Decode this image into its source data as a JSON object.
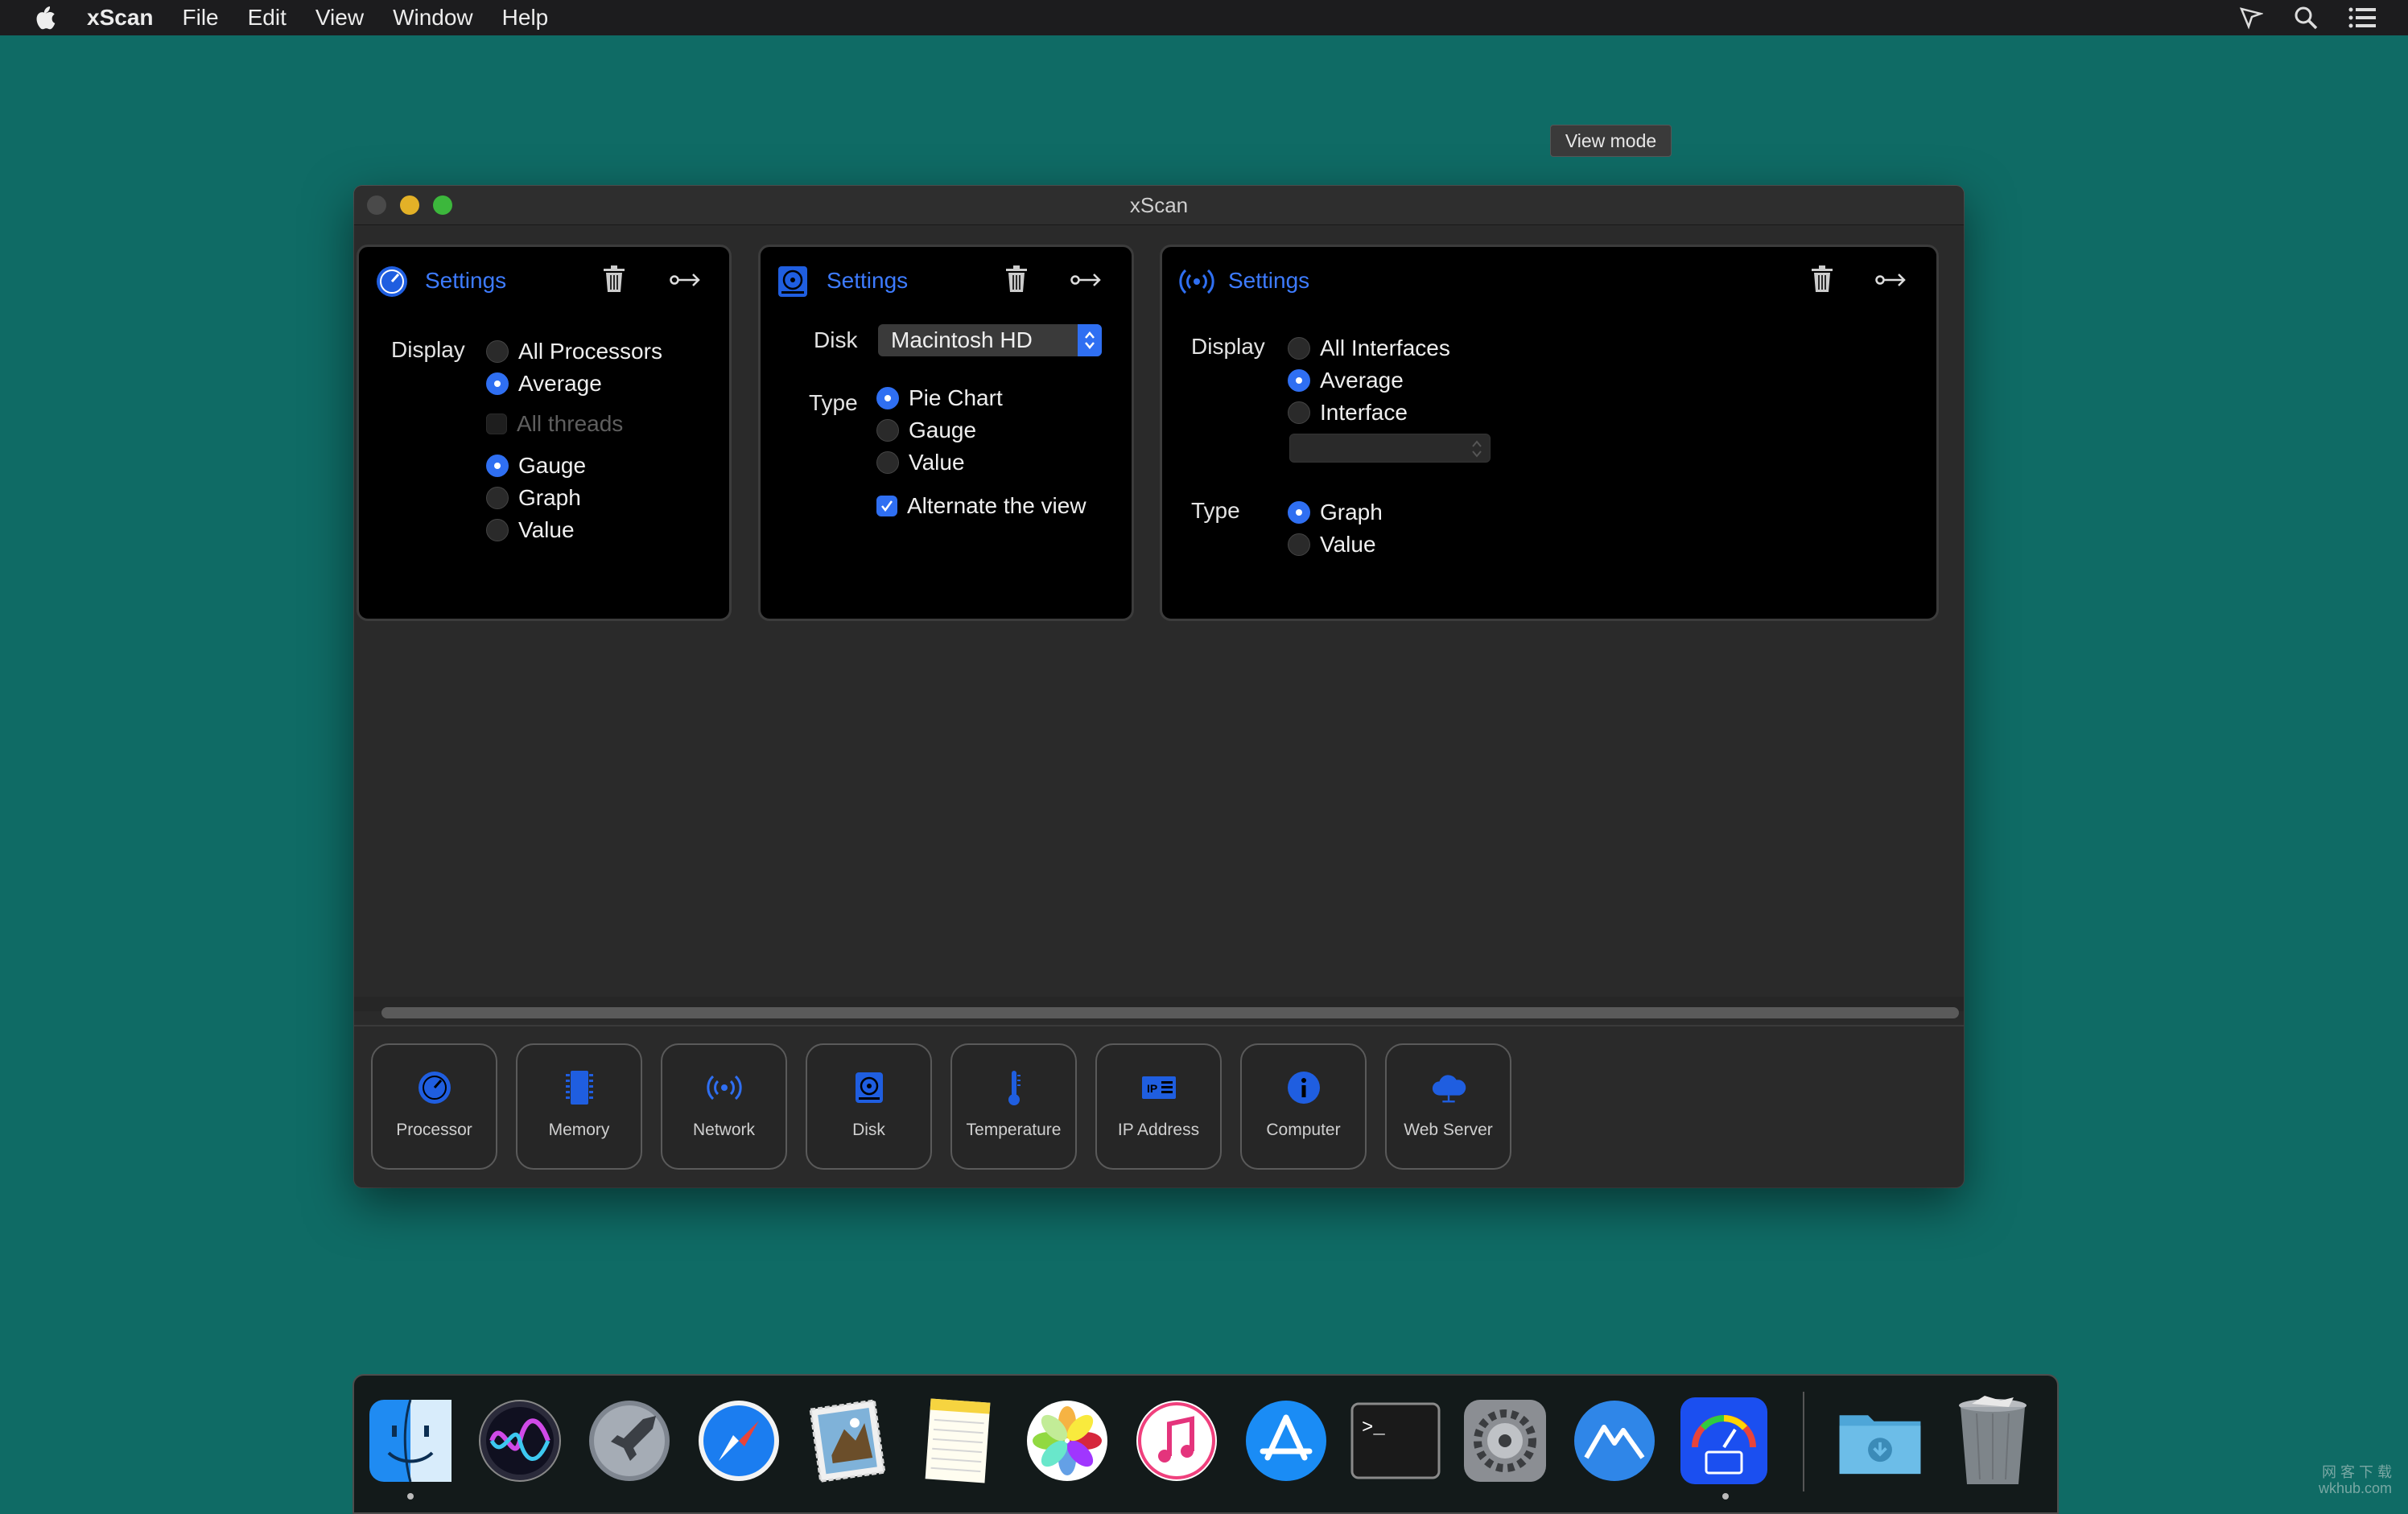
{
  "menubar": {
    "app_name": "xScan",
    "items": [
      "File",
      "Edit",
      "View",
      "Window",
      "Help"
    ]
  },
  "window": {
    "title": "xScan"
  },
  "processor_panel": {
    "title": "Settings",
    "display_label": "Display",
    "options": [
      {
        "label": "All Processors",
        "selected": false
      },
      {
        "label": "Average",
        "selected": true
      }
    ],
    "threads_checkbox": {
      "label": "All threads",
      "checked": false,
      "disabled": true
    },
    "view_options": [
      {
        "label": "Gauge",
        "selected": true
      },
      {
        "label": "Graph",
        "selected": false
      },
      {
        "label": "Value",
        "selected": false
      }
    ]
  },
  "disk_panel": {
    "title": "Settings",
    "disk_label": "Disk",
    "disk_value": "Macintosh HD",
    "type_label": "Type",
    "type_options": [
      {
        "label": "Pie Chart",
        "selected": true
      },
      {
        "label": "Gauge",
        "selected": false
      },
      {
        "label": "Value",
        "selected": false
      }
    ],
    "alternate_checkbox": {
      "label": "Alternate the view",
      "checked": true
    }
  },
  "network_panel": {
    "title": "Settings",
    "display_label": "Display",
    "display_options": [
      {
        "label": "All Interfaces",
        "selected": false
      },
      {
        "label": "Average",
        "selected": true
      },
      {
        "label": "Interface",
        "selected": false
      }
    ],
    "interface_value": "",
    "type_label": "Type",
    "type_options": [
      {
        "label": "Graph",
        "selected": true
      },
      {
        "label": "Value",
        "selected": false
      }
    ]
  },
  "tooltip": {
    "text": "View mode"
  },
  "modules": [
    {
      "label": "Processor",
      "icon": "gauge-icon"
    },
    {
      "label": "Memory",
      "icon": "memory-chip-icon"
    },
    {
      "label": "Network",
      "icon": "antenna-icon"
    },
    {
      "label": "Disk",
      "icon": "disk-icon"
    },
    {
      "label": "Temperature",
      "icon": "thermometer-icon"
    },
    {
      "label": "IP Address",
      "icon": "ip-card-icon"
    },
    {
      "label": "Computer",
      "icon": "info-icon"
    },
    {
      "label": "Web Server",
      "icon": "cloud-icon"
    }
  ],
  "dock": {
    "apps": [
      "Finder",
      "Siri",
      "Launchpad",
      "Safari",
      "Mail",
      "Notes",
      "Photos",
      "iTunes",
      "App Store",
      "Terminal",
      "System Preferences",
      "Monterey",
      "xScan"
    ],
    "stacks": [
      "Downloads",
      "Trash"
    ]
  },
  "watermark": {
    "line1": "网 客 下 载",
    "line2": "wkhub.com"
  },
  "colors": {
    "desktop": "#0f6b65",
    "accent": "#2f6ff2",
    "panel_title": "#3d7bff",
    "window_bg": "#2a2a2a"
  }
}
